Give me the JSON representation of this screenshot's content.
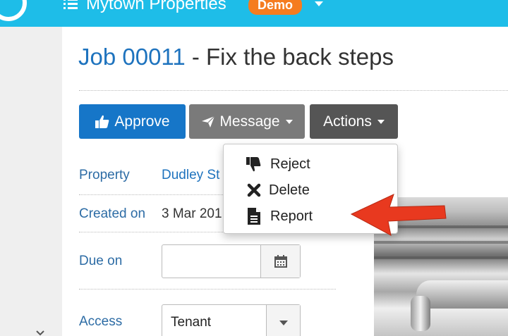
{
  "app": {
    "title": "Mytown Properties",
    "badge": "Demo"
  },
  "page": {
    "job_number": "Job 00011",
    "job_title_rest": " - Fix the back steps"
  },
  "toolbar": {
    "approve_label": "Approve",
    "message_label": "Message",
    "actions_label": "Actions"
  },
  "actions_menu": {
    "items": [
      {
        "label": "Reject",
        "icon": "thumbs-down-icon"
      },
      {
        "label": "Delete",
        "icon": "close-icon"
      },
      {
        "label": "Report",
        "icon": "document-icon"
      }
    ]
  },
  "fields": {
    "property_label": "Property",
    "property_value": "Dudley St",
    "created_label": "Created on",
    "created_value": "3 Mar 201",
    "due_label": "Due on",
    "due_value": "",
    "access_label": "Access",
    "access_value": "Tenant"
  },
  "colors": {
    "topbar": "#1ebde8",
    "badge": "#f57c1f",
    "approve": "#1676c8",
    "message": "#7a7a7a",
    "actions": "#555555",
    "link": "#1e73be",
    "arrow": "#e8391f"
  }
}
